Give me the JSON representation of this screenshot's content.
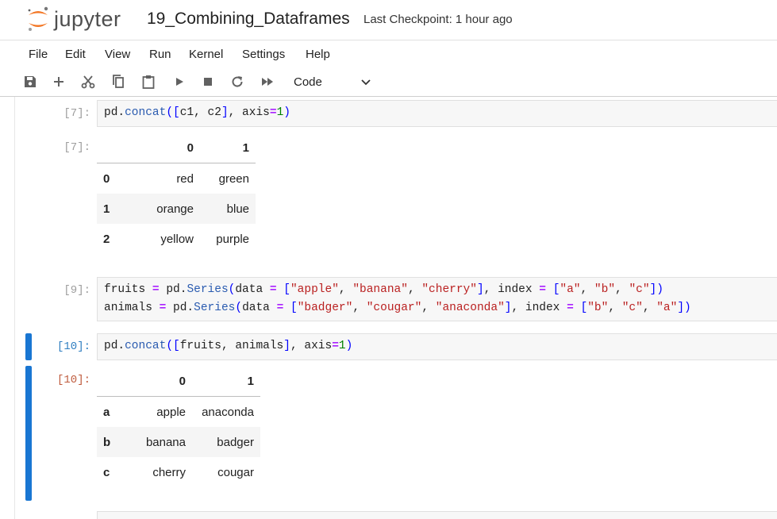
{
  "header": {
    "logo_text": "jupyter",
    "notebook_title": "19_Combining_Dataframes",
    "checkpoint": "Last Checkpoint: 1 hour ago"
  },
  "menu": [
    "File",
    "Edit",
    "View",
    "Run",
    "Kernel",
    "Settings",
    "Help"
  ],
  "toolbar": {
    "icons": [
      "save-icon",
      "add-cell-icon",
      "cut-icon",
      "copy-icon",
      "paste-icon",
      "run-icon",
      "stop-icon",
      "restart-icon",
      "run-all-icon"
    ],
    "cell_type": "Code"
  },
  "cells": [
    {
      "in_prompt": "[7]:",
      "code_lines": [
        "pd.concat([c1, c2], axis=1)"
      ],
      "out_prompt": "[7]:",
      "table": {
        "columns": [
          "0",
          "1"
        ],
        "rows": [
          {
            "index": "0",
            "values": [
              "red",
              "green"
            ]
          },
          {
            "index": "1",
            "values": [
              "orange",
              "blue"
            ]
          },
          {
            "index": "2",
            "values": [
              "yellow",
              "purple"
            ]
          }
        ]
      }
    },
    {
      "in_prompt": "[9]:",
      "code_lines": [
        "fruits = pd.Series(data = [\"apple\", \"banana\", \"cherry\"], index = [\"a\", \"b\", \"c\"])",
        "animals = pd.Series(data = [\"badger\", \"cougar\", \"anaconda\"], index = [\"b\", \"c\", \"a\"])"
      ]
    },
    {
      "in_prompt": "[10]:",
      "code_lines": [
        "pd.concat([fruits, animals], axis=1)"
      ],
      "out_prompt": "[10]:",
      "active": true,
      "table": {
        "columns": [
          "0",
          "1"
        ],
        "rows": [
          {
            "index": "a",
            "values": [
              "apple",
              "anaconda"
            ]
          },
          {
            "index": "b",
            "values": [
              "banana",
              "badger"
            ]
          },
          {
            "index": "c",
            "values": [
              "cherry",
              "cougar"
            ]
          }
        ]
      }
    }
  ],
  "colors": {
    "active_bar": "#1976d2",
    "logo_orange": "#f37726",
    "in_prompt_active": "#307fc1",
    "out_prompt_active": "#bf5b3d"
  }
}
